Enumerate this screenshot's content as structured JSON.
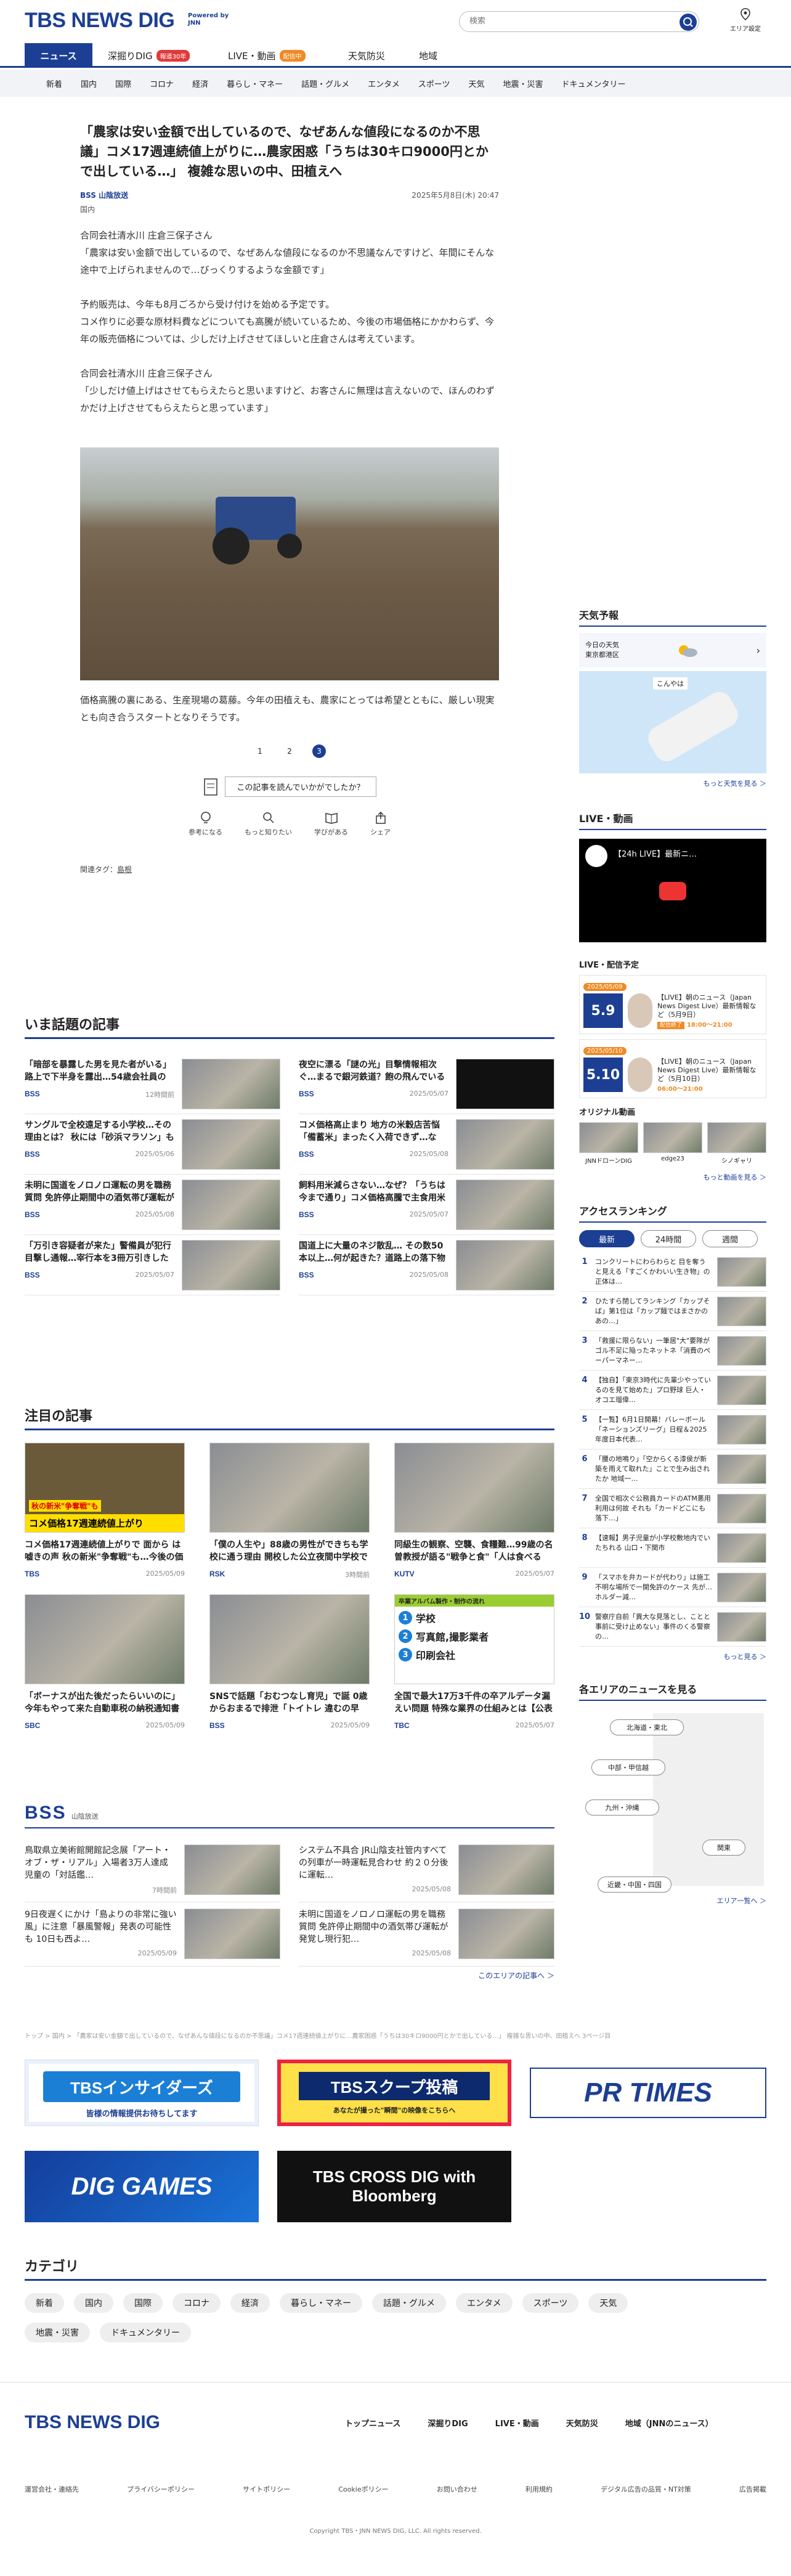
{
  "header": {
    "logo": "TBS NEWS DIG",
    "powered": "Powered by JNN",
    "search_placeholder": "検索",
    "area_label": "エリア設定"
  },
  "nav": {
    "items": [
      {
        "label": "ニュース"
      },
      {
        "label": "深掘りDIG",
        "badge": "報道30年"
      },
      {
        "label": "LIVE・動画",
        "badge": "配信中"
      },
      {
        "label": "天気防災"
      },
      {
        "label": "地域"
      }
    ]
  },
  "subnav": [
    "新着",
    "国内",
    "国際",
    "コロナ",
    "経済",
    "暮らし・マネー",
    "話題・グルメ",
    "エンタメ",
    "スポーツ",
    "天気",
    "地震・災害",
    "ドキュメンタリー"
  ],
  "article": {
    "title": "「農家は安い金額で出しているので、なぜあんな値段になるのか不思議」コメ17週連続値上がりに…農家困惑「うちは30キロ9000円とかで出している…」 複雑な思いの中、田植えへ",
    "source": "BSS 山陰放送",
    "date": "2025年5月8日(木) 20:47",
    "category": "国内",
    "p1_name": "合同会社清水川 庄倉三保子さん",
    "p1": "「農家は安い金額で出しているので、なぜあんな値段になるのか不思議なんですけど、年間にそんな途中で上げられませんので…びっくりするような金額です」",
    "p2": "予約販売は、今年も8月ごろから受け付けを始める予定です。\nコメ作りに必要な原材料費などについても高騰が続いているため、今後の市場価格にかかわらず、今年の販売価格については、少しだけ上げさせてほしいと庄倉さんは考えています。",
    "p3_name": "合同会社清水川 庄倉三保子さん",
    "p3": "「少しだけ値上げはさせてもらえたらと思いますけど、お客さんに無理は言えないので、ほんのわずかだけ上げさせてもらえたらと思っています」",
    "p4": "価格高騰の裏にある、生産現場の葛藤。今年の田植えも、農家にとっては希望とともに、厳しい現実とも向き合うスタートとなりそうです。",
    "pages": [
      "1",
      "2",
      "3"
    ],
    "feedback": "この記事を読んでいかがでしたか？",
    "reactions": [
      "参考になる",
      "もっと知りたい",
      "学びがある",
      "シェア"
    ],
    "tags_label": "関連タグ：",
    "tag": "島根"
  },
  "trending": {
    "title": "いま話題の記事",
    "items": [
      {
        "title": "「暗部を暴露した男を見た者がいる」路上で下半身を露出…54歳会社員の男を再逮…",
        "src": "BSS",
        "date": "12時間前"
      },
      {
        "title": "夜空に漂る「謎の光」目撃情報相次ぐ…まるで銀河鉄道？飽の飛んでいる姿？星…",
        "src": "BSS",
        "date": "2025/05/07"
      },
      {
        "title": "サングルで全校遠足する小学校…その理由とは？ 秋には「砂浜マラソン」も 鳥取…",
        "src": "BSS",
        "date": "2025/05/06"
      },
      {
        "title": "コメ価格高止まり 地方の米穀店苦悩「備蓄米」まったく入荷できず…なぜ？「もう…",
        "src": "BSS",
        "date": "2025/05/08"
      },
      {
        "title": "未明に国道をノロノロ運転の男を職務質問 免許停止期間中の酒気帯び運転が発覚し…",
        "src": "BSS",
        "date": "2025/05/08"
      },
      {
        "title": "飼料用米減らさない…なぜ？「うちは今まで通り」コメ価格高騰で主食用米作付け増…",
        "src": "BSS",
        "date": "2025/05/07"
      },
      {
        "title": "「万引き容疑者が来た」警備員が犯行目撃し通報…宰行本を3冊万引きした疑い 地方…",
        "src": "BSS",
        "date": "2025/05/07"
      },
      {
        "title": "国道上に大量のネジ散乱… その数50本以上…何が起きた？道路上の落下物などで共…",
        "src": "BSS",
        "date": "2025/05/08"
      }
    ]
  },
  "featured": {
    "title": "注目の記事",
    "items": [
      {
        "title": "コメ価格17週連続値上がりで 面から は嘘きの声 秋の新米\"争奪戦\"も…今後の価格、秋の新米価…",
        "src": "TBS",
        "date": "2025/05/09",
        "banner": "コメ価格17週連続値上がり",
        "bannertop": "秋の新米\"争奪戦\"も"
      },
      {
        "title": "「僕の人生や」88歳の男性ができちも学校に通う理由 開校した公立夜間中学校で「もう一度学びたい」…",
        "src": "RSK",
        "date": "3時間前"
      },
      {
        "title": "同級生の観察、空襲、食糧難…99歳の名曽教授が語る\"戦争と食\"「人は食べる時、心が素直に。食がち…",
        "src": "KUTV",
        "date": "2025/05/07"
      },
      {
        "title": "「ボーナスが出た後だったらいいのに」今年もやって来た自動車税の納税通知書 納付期限が5月末な…",
        "src": "SBC",
        "date": "2025/05/09"
      },
      {
        "title": "SNSで話題「おむつなし育児」で誕 0歳からおまるで排泄「トイトレ 違むの早い」「親の努力が…",
        "src": "BSS",
        "date": "2025/05/09"
      },
      {
        "title": "全国で最大17万3千件の卒アルデータ漏えい問題 特殊な業界の仕組みとは【公表学校名一覧掲載】",
        "src": "TBC",
        "date": "2025/05/07",
        "list": [
          "学校",
          "写真館,撮影業者",
          "印刷会社"
        ],
        "listhead": "卒業アルバム製作・制作の流れ"
      }
    ]
  },
  "bss_section": {
    "logo": "BSS",
    "sub": "山陰放送",
    "items": [
      {
        "title": "鳥取県立美術館開館記念展「アート・オブ・ザ・リアル」入場者3万人達成 児童の「対話鑑…",
        "date": "7時間前"
      },
      {
        "title": "システム不具合 JR山陰支社管内すべての列車が一時運転見合わせ 約２０分後に運転…",
        "date": "2025/05/08"
      },
      {
        "title": "9日夜遅くにかけ「島よりの非常に強い風」に注意「暴風警報」発表の可能性も 10日も西よ…",
        "date": "2025/05/09"
      },
      {
        "title": "未明に国道をノロノロ運転の男を職務質問 免許停止期間中の酒気帯び運転が発覚し現行犯…",
        "date": "2025/05/08"
      }
    ],
    "more": "このエリアの記事へ ＞"
  },
  "breadcrumb": "トップ > 国内 > 「農家は安い金額で出しているので、なぜあんな値段になるのか不思議」コメ17週連続値上がりに…農家困惑「うちは30キロ9000円とかで出している…」 複雑な思いの中、田植えへ 3ページ目",
  "banners": [
    "TBSインサイダーズ",
    "TBSスクープ投稿",
    "PR TIMES",
    "DIG GAMES",
    "TBS CROSS DIG with Bloomberg"
  ],
  "banner_sub": [
    "皆様の情報提供お待ちしてます",
    "あなたが撮った\"瞬間\"の映像をこちらへ"
  ],
  "categories": {
    "title": "カテゴリ",
    "items": [
      "新着",
      "国内",
      "国際",
      "コロナ",
      "経済",
      "暮らし・マネー",
      "話題・グルメ",
      "エンタメ",
      "スポーツ",
      "天気",
      "地震・災害",
      "ドキュメンタリー"
    ]
  },
  "sidebar": {
    "weather": {
      "title": "天気予報",
      "today": "今日の天気",
      "area": "東京都港区",
      "more": "もっと天気を見る ＞",
      "map_label": "こんやは"
    },
    "live": {
      "title": "LIVE・動画",
      "video_label": "【24h LIVE】最新ニ…",
      "schedule_title": "LIVE・配信予定",
      "items": [
        {
          "date_badge": "5.9",
          "day": "2025/05/09",
          "title": "【LIVE】朝のニュース（Japan News Digest Live）最新情報など（5月9日）",
          "status": "配信終了",
          "time": "18:00～21:00"
        },
        {
          "date_badge": "5.10",
          "day": "2025/05/10",
          "title": "【LIVE】朝のニュース（Japan News Digest Live）最新情報など（5月10日）",
          "status": "",
          "time": "06:00～21:00"
        }
      ],
      "orig_title": "オリジナル動画",
      "orig": [
        "JNNドローンDIG",
        "edge23",
        "シノギャリ"
      ],
      "more": "もっと動画を見る ＞"
    },
    "ranking": {
      "title": "アクセスランキング",
      "tabs": [
        "最新",
        "24時間",
        "週間"
      ],
      "items": [
        "コンクリートにわらわらと 目を奪うと見える「すごくかわいい生き物」の正体は…",
        "ひたすら閉してランキング「カップそば」第1位は「カップ麺ではまさかのあの…」",
        "「救援に限らない」一筆居\"大\"要隊がゴル不足に陥ったネットネ「消費のペーパーマネー…",
        "【独自】「東京3時代に先輩少やっているのを見て始めた」プロ野球 巨人・オコエ瑠偉…",
        "【一覧】6月1日開幕！バレーボール「ネーションズリーグ」日程＆2025年度日本代表…",
        "「腰の地鳴り」「空からくる漆侯が新築を雨えて取れた」ことで生み出されたか 地域一…",
        "全国で相次ぐ公務員カードのATM悪用利用は何故 それも「カードどこにも落下…」",
        "【速報】男子児童が小学校敷地内でいたちれる 山口・下関市",
        "「スマホを弁カードが代わり」は施工 不明な場所で一開免許のケース 先が…ホルダー減…",
        "警察庁自前「異大な見落とし、ことと事前に受け止めない」事件のくる警察の…"
      ],
      "more": "もっと見る ＞"
    },
    "areas": {
      "title": "各エリアのニュースを見る",
      "items": [
        "北海道・東北",
        "中部・甲信越",
        "九州・沖縄",
        "関東",
        "近畿・中国・四国"
      ],
      "more": "エリア一覧へ ＞"
    }
  },
  "footer": {
    "logo": "TBS NEWS DIG",
    "nav": [
      "トップニュース",
      "深掘りDIG",
      "LIVE・動画",
      "天気防災",
      "地域（JNNのニュース）"
    ],
    "links": [
      "運営会社・連絡先",
      "プライバシーポリシー",
      "サイトポリシー",
      "Cookieポリシー",
      "お問い合わせ",
      "利用規約",
      "デジタル広告の品質・NT対策",
      "広告掲載"
    ],
    "copyright": "Copyright TBS・JNN NEWS DIG, LLC. All rights reserved."
  }
}
